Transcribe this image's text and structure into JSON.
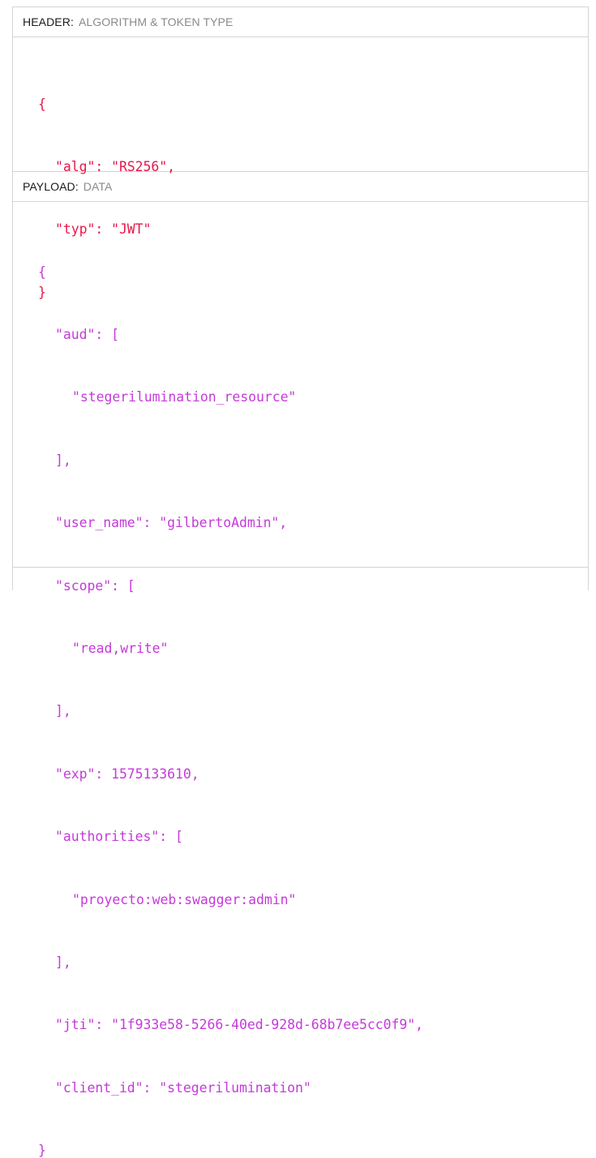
{
  "header_section": {
    "label": "HEADER",
    "separator": ":",
    "description": "ALGORITHM & TOKEN TYPE",
    "code_lines": [
      "{",
      "\"alg\": \"RS256\",",
      "\"typ\": \"JWT\"",
      "}"
    ]
  },
  "payload_section": {
    "label": "PAYLOAD",
    "separator": ":",
    "description": "DATA",
    "code_lines": [
      "{",
      "\"aud\": [",
      "\"stegerilumination_resource\"",
      "],",
      "\"user_name\": \"gilbertoAdmin\",",
      "\"scope\": [",
      "\"read,write\"",
      "],",
      "\"exp\": 1575133610,",
      "\"authorities\": [",
      "\"proyecto:web:swagger:admin\"",
      "],",
      "\"jti\": \"1f933e58-5266-40ed-928d-68b7ee5cc0f9\",",
      "\"client_id\": \"stegerilumination\"",
      "}"
    ]
  },
  "colors": {
    "header_code": "#e8174a",
    "payload_code": "#c43ad9",
    "border": "#d4d4d4",
    "description_text": "#8a8a8a"
  }
}
